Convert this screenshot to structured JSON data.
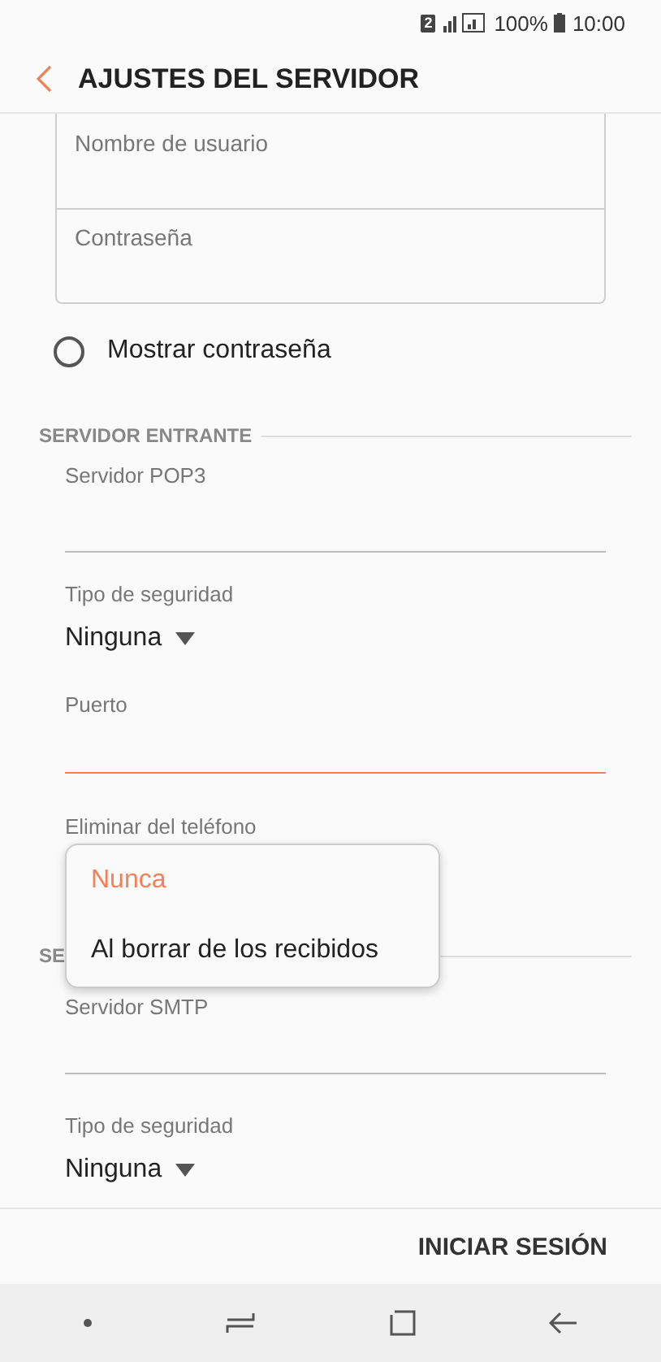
{
  "status_bar": {
    "sim_badge": "2",
    "battery": "100%",
    "time": "10:00"
  },
  "header": {
    "title": "AJUSTES DEL SERVIDOR"
  },
  "account_fields": [
    {
      "placeholder": "Nombre de usuario"
    },
    {
      "placeholder": "Contraseña"
    }
  ],
  "show_password": {
    "label": "Mostrar contraseña",
    "checked": false
  },
  "sections": [
    {
      "title": "SERVIDOR ENTRANTE",
      "items": [
        {
          "kind": "text",
          "label": "Servidor POP3",
          "focused": false
        },
        {
          "kind": "select",
          "label": "Tipo de seguridad",
          "value": "Ninguna"
        },
        {
          "kind": "text",
          "label": "Puerto",
          "focused": true
        },
        {
          "kind": "open_select",
          "label": "Eliminar del teléfono"
        }
      ]
    },
    {
      "title": "SE",
      "items": [
        {
          "kind": "text",
          "label": "Servidor SMTP",
          "focused": false
        },
        {
          "kind": "select",
          "label": "Tipo de seguridad",
          "value": "Ninguna"
        }
      ]
    }
  ],
  "dropdown_menu": {
    "options": [
      {
        "label": "Nunca",
        "selected": true
      },
      {
        "label": "Al borrar de los recibidos",
        "selected": false
      }
    ]
  },
  "footer": {
    "button": "INICIAR SESIÓN"
  }
}
